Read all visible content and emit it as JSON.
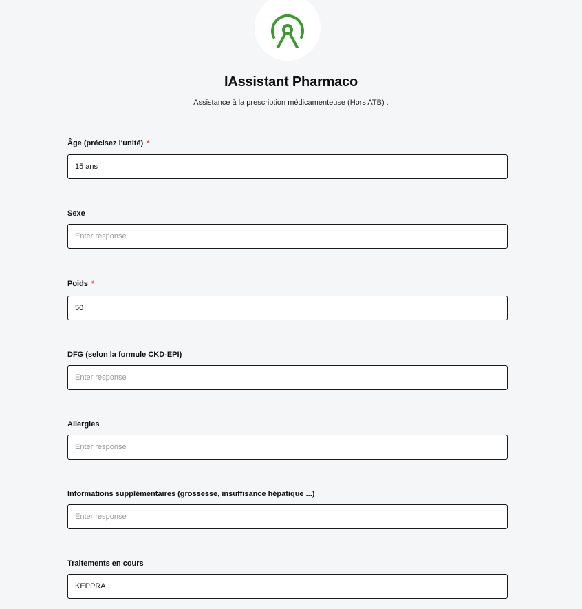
{
  "header": {
    "logo_icon": "user-arch-icon",
    "accent_color": "#3a9a2a",
    "title": "IAssistant Pharmaco",
    "subtitle": "Assistance à la prescription médicamenteuse (Hors ATB) ."
  },
  "form": {
    "required_marker": "*",
    "fields": [
      {
        "label": "Âge (précisez l'unité)",
        "required": true,
        "value": "15 ans",
        "placeholder": "Enter response"
      },
      {
        "label": "Sexe",
        "required": false,
        "value": "",
        "placeholder": "Enter response"
      },
      {
        "label": "Poids",
        "required": true,
        "value": "50",
        "placeholder": "Enter response"
      },
      {
        "label": "DFG (selon la formule CKD-EPI)",
        "required": false,
        "value": "",
        "placeholder": "Enter response"
      },
      {
        "label": "Allergies",
        "required": false,
        "value": "",
        "placeholder": "Enter response"
      },
      {
        "label": "Informations supplémentaires (grossesse, insuffisance hépatique ...)",
        "required": false,
        "value": "",
        "placeholder": "Enter response"
      },
      {
        "label": "Traitements en cours",
        "required": false,
        "value": "KEPPRA",
        "placeholder": "Enter response"
      }
    ]
  }
}
